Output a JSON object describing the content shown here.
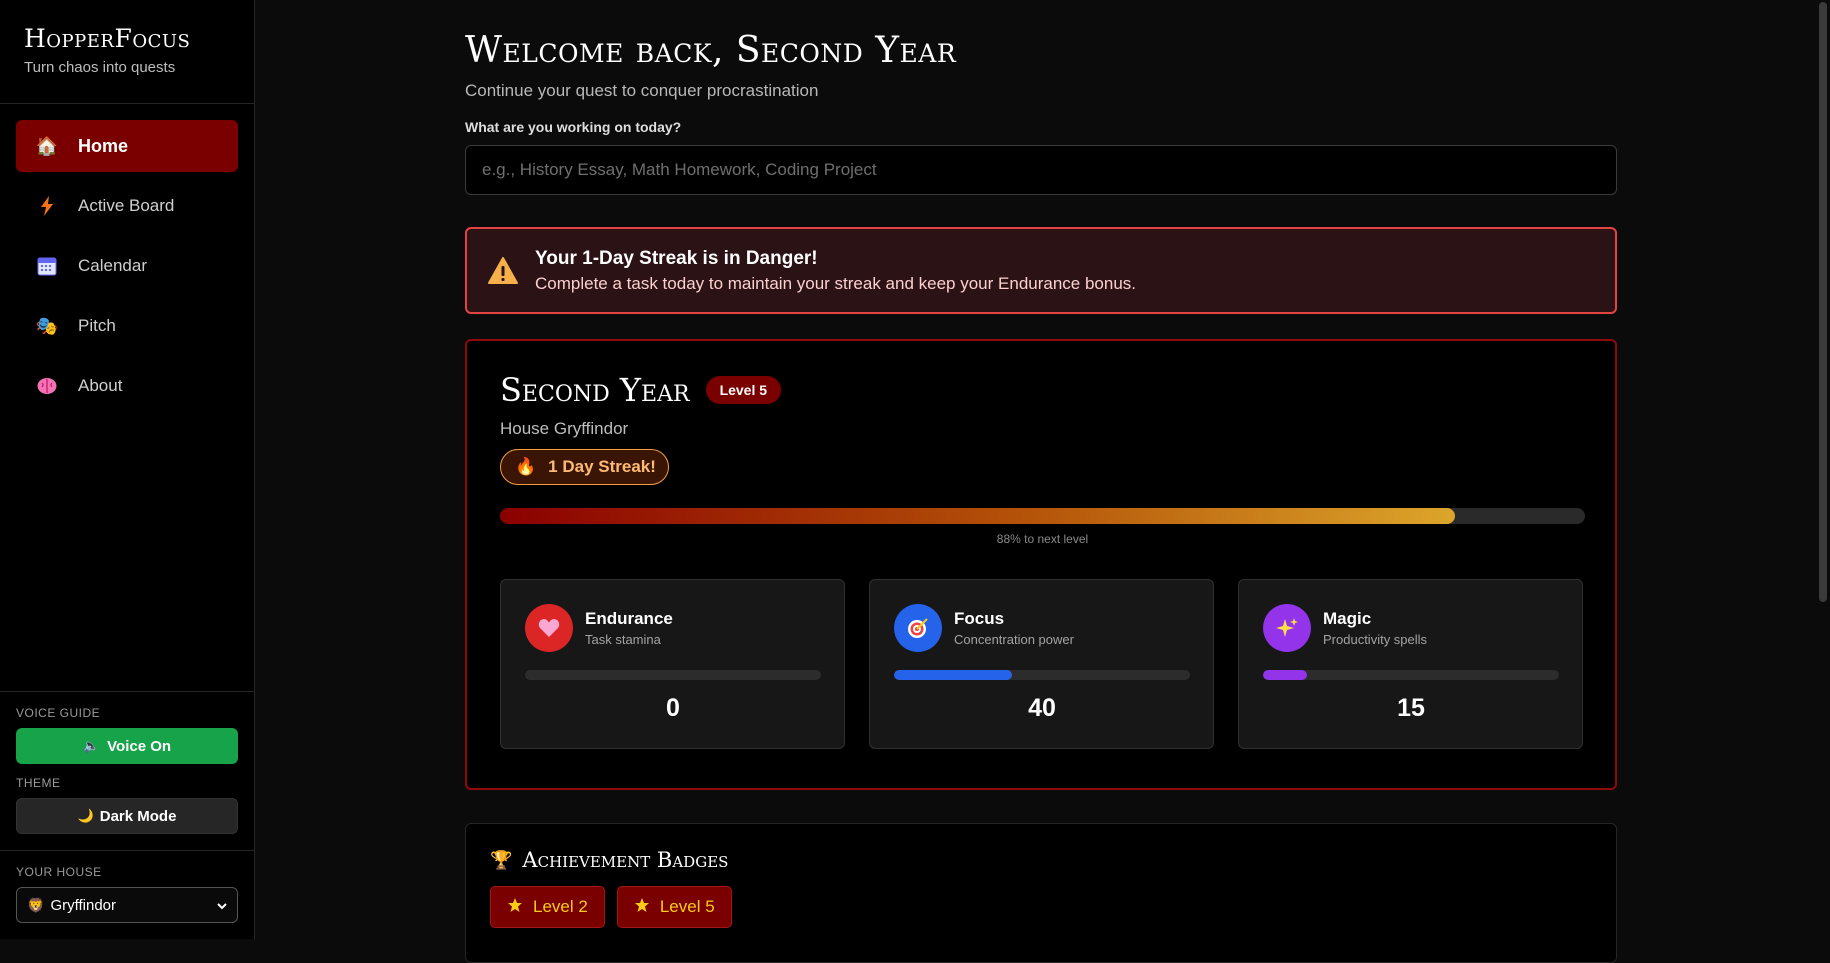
{
  "brand": {
    "title": "HopperFocus",
    "subtitle": "Turn chaos into quests"
  },
  "nav": {
    "items": [
      {
        "label": "Home",
        "icon": "home-icon"
      },
      {
        "label": "Active Board",
        "icon": "lightning-icon"
      },
      {
        "label": "Calendar",
        "icon": "calendar-icon"
      },
      {
        "label": "Pitch",
        "icon": "theater-masks-icon"
      },
      {
        "label": "About",
        "icon": "brain-icon"
      }
    ],
    "active": "Home"
  },
  "sidebar": {
    "voice_label": "VOICE GUIDE",
    "voice_button": "Voice On",
    "theme_label": "THEME",
    "theme_button": "Dark Mode",
    "house_label": "YOUR HOUSE",
    "house_selected": "Gryffindor"
  },
  "header": {
    "welcome": "Welcome back, Second Year",
    "subtitle": "Continue your quest to conquer procrastination"
  },
  "task": {
    "label": "What are you working on today?",
    "placeholder": "e.g., History Essay, Math Homework, Coding Project",
    "value": ""
  },
  "alert": {
    "title": "Your 1-Day Streak is in Danger!",
    "text": "Complete a task today to maintain your streak and keep your Endurance bonus."
  },
  "profile": {
    "name": "Second Year",
    "level_badge": "Level 5",
    "house": "House Gryffindor",
    "streak": "1 Day Streak!",
    "xp_percent": 88,
    "xp_caption": "88% to next level"
  },
  "stats": [
    {
      "title": "Endurance",
      "subtitle": "Task stamina",
      "value": "0",
      "fraction": 0,
      "color": "#dc2626",
      "icon": "heart-icon"
    },
    {
      "title": "Focus",
      "subtitle": "Concentration power",
      "value": "40",
      "fraction": 0.4,
      "color": "#2563eb",
      "icon": "target-icon"
    },
    {
      "title": "Magic",
      "subtitle": "Productivity spells",
      "value": "15",
      "fraction": 0.15,
      "color": "#9333ea",
      "icon": "sparkles-icon"
    }
  ],
  "badges": {
    "title": "Achievement Badges",
    "items": [
      "Level 2",
      "Level 5"
    ]
  },
  "colors": {
    "accent": "#7a0000",
    "voice_green": "#16a34a",
    "alert_border": "#e24444",
    "badge_text": "#facc15"
  }
}
